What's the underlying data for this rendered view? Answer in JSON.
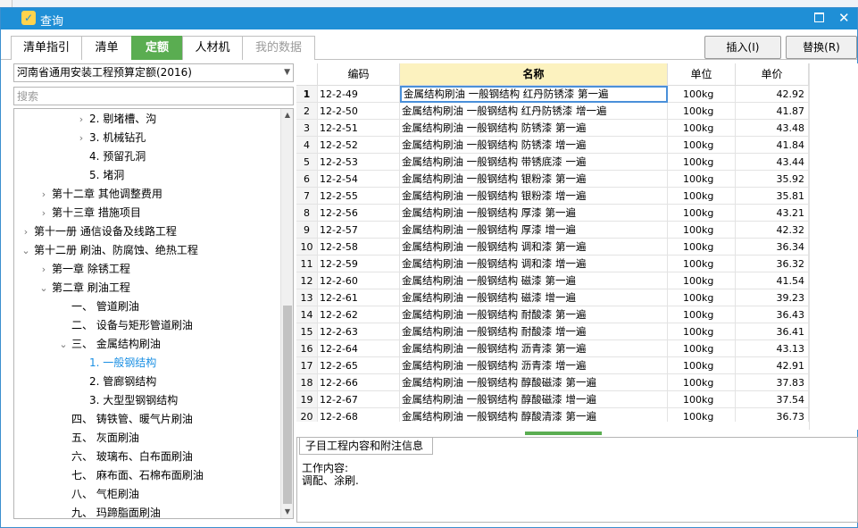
{
  "window": {
    "title": "查询"
  },
  "tabs": [
    {
      "label": "清单指引",
      "state": "normal"
    },
    {
      "label": "清单",
      "state": "normal"
    },
    {
      "label": "定额",
      "state": "active"
    },
    {
      "label": "人材机",
      "state": "normal"
    },
    {
      "label": "我的数据",
      "state": "disabled"
    }
  ],
  "buttons": {
    "insert": "插入(I)",
    "replace": "替换(R)"
  },
  "quota_library": "河南省通用安装工程预算定额(2016)",
  "search": {
    "placeholder": "搜索",
    "value": ""
  },
  "tree": [
    {
      "label": "2. 剔堵槽、沟",
      "level": 4,
      "toggle": "collapsed"
    },
    {
      "label": "3. 机械钻孔",
      "level": 4,
      "toggle": "collapsed"
    },
    {
      "label": "4. 预留孔洞",
      "level": 4,
      "toggle": "none"
    },
    {
      "label": "5. 堵洞",
      "level": 4,
      "toggle": "none"
    },
    {
      "label": "第十二章 其他调整费用",
      "level": 2,
      "toggle": "collapsed"
    },
    {
      "label": "第十三章 措施项目",
      "level": 2,
      "toggle": "collapsed"
    },
    {
      "label": "第十一册 通信设备及线路工程",
      "level": 1,
      "toggle": "collapsed"
    },
    {
      "label": "第十二册 刷油、防腐蚀、绝热工程",
      "level": 1,
      "toggle": "expanded"
    },
    {
      "label": "第一章 除锈工程",
      "level": 2,
      "toggle": "collapsed"
    },
    {
      "label": "第二章 刷油工程",
      "level": 2,
      "toggle": "expanded"
    },
    {
      "label": "一、 管道刷油",
      "level": 3,
      "toggle": "none"
    },
    {
      "label": "二、 设备与矩形管道刷油",
      "level": 3,
      "toggle": "none"
    },
    {
      "label": "三、 金属结构刷油",
      "level": 3,
      "toggle": "expanded"
    },
    {
      "label": "1. 一般钢结构",
      "level": 4,
      "toggle": "none",
      "selected": true
    },
    {
      "label": "2. 管廊钢结构",
      "level": 4,
      "toggle": "none"
    },
    {
      "label": "3. 大型型钢钢结构",
      "level": 4,
      "toggle": "none"
    },
    {
      "label": "四、 铸铁管、暖气片刷油",
      "level": 3,
      "toggle": "none"
    },
    {
      "label": "五、 灰面刷油",
      "level": 3,
      "toggle": "none"
    },
    {
      "label": "六、 玻璃布、白布面刷油",
      "level": 3,
      "toggle": "none"
    },
    {
      "label": "七、 麻布面、石棉布面刷油",
      "level": 3,
      "toggle": "none"
    },
    {
      "label": "八、 气柜刷油",
      "level": 3,
      "toggle": "none"
    },
    {
      "label": "九、 玛蹄脂面刷油",
      "level": 3,
      "toggle": "none"
    }
  ],
  "grid": {
    "columns": {
      "code": "编码",
      "name": "名称",
      "unit": "单位",
      "price": "单价"
    },
    "rows": [
      {
        "no": "1",
        "code": "12-2-49",
        "name": "金属结构刷油 一般钢结构 红丹防锈漆 第一遍",
        "unit": "100kg",
        "price": "42.92"
      },
      {
        "no": "2",
        "code": "12-2-50",
        "name": "金属结构刷油 一般钢结构 红丹防锈漆 增一遍",
        "unit": "100kg",
        "price": "41.87"
      },
      {
        "no": "3",
        "code": "12-2-51",
        "name": "金属结构刷油 一般钢结构 防锈漆 第一遍",
        "unit": "100kg",
        "price": "43.48"
      },
      {
        "no": "4",
        "code": "12-2-52",
        "name": "金属结构刷油 一般钢结构 防锈漆 增一遍",
        "unit": "100kg",
        "price": "41.84"
      },
      {
        "no": "5",
        "code": "12-2-53",
        "name": "金属结构刷油 一般钢结构 带锈底漆 一遍",
        "unit": "100kg",
        "price": "43.44"
      },
      {
        "no": "6",
        "code": "12-2-54",
        "name": "金属结构刷油 一般钢结构 银粉漆 第一遍",
        "unit": "100kg",
        "price": "35.92"
      },
      {
        "no": "7",
        "code": "12-2-55",
        "name": "金属结构刷油 一般钢结构 银粉漆 增一遍",
        "unit": "100kg",
        "price": "35.81"
      },
      {
        "no": "8",
        "code": "12-2-56",
        "name": "金属结构刷油 一般钢结构 厚漆 第一遍",
        "unit": "100kg",
        "price": "43.21"
      },
      {
        "no": "9",
        "code": "12-2-57",
        "name": "金属结构刷油 一般钢结构 厚漆 增一遍",
        "unit": "100kg",
        "price": "42.32"
      },
      {
        "no": "10",
        "code": "12-2-58",
        "name": "金属结构刷油 一般钢结构 调和漆 第一遍",
        "unit": "100kg",
        "price": "36.34"
      },
      {
        "no": "11",
        "code": "12-2-59",
        "name": "金属结构刷油 一般钢结构 调和漆 增一遍",
        "unit": "100kg",
        "price": "36.32"
      },
      {
        "no": "12",
        "code": "12-2-60",
        "name": "金属结构刷油 一般钢结构 磁漆 第一遍",
        "unit": "100kg",
        "price": "41.54"
      },
      {
        "no": "13",
        "code": "12-2-61",
        "name": "金属结构刷油 一般钢结构 磁漆 增一遍",
        "unit": "100kg",
        "price": "39.23"
      },
      {
        "no": "14",
        "code": "12-2-62",
        "name": "金属结构刷油 一般钢结构 耐酸漆 第一遍",
        "unit": "100kg",
        "price": "36.43"
      },
      {
        "no": "15",
        "code": "12-2-63",
        "name": "金属结构刷油 一般钢结构 耐酸漆 增一遍",
        "unit": "100kg",
        "price": "36.41"
      },
      {
        "no": "16",
        "code": "12-2-64",
        "name": "金属结构刷油 一般钢结构 沥青漆 第一遍",
        "unit": "100kg",
        "price": "43.13"
      },
      {
        "no": "17",
        "code": "12-2-65",
        "name": "金属结构刷油 一般钢结构 沥青漆 增一遍",
        "unit": "100kg",
        "price": "42.91"
      },
      {
        "no": "18",
        "code": "12-2-66",
        "name": "金属结构刷油 一般钢结构 醇酸磁漆 第一遍",
        "unit": "100kg",
        "price": "37.83"
      },
      {
        "no": "19",
        "code": "12-2-67",
        "name": "金属结构刷油 一般钢结构 醇酸磁漆 增一遍",
        "unit": "100kg",
        "price": "37.54"
      },
      {
        "no": "20",
        "code": "12-2-68",
        "name": "金属结构刷油 一般钢结构 醇酸清漆 第一遍",
        "unit": "100kg",
        "price": "36.73"
      }
    ]
  },
  "bottom": {
    "tab": "子目工程内容和附注信息",
    "content_label": "工作内容:",
    "content_text": "调配、涂刷."
  },
  "colors": {
    "titlebar": "#1f8fd6",
    "active_tab": "#5aad51",
    "selected_tree": "#1a8fe3",
    "name_header": "#fcf2bf"
  }
}
